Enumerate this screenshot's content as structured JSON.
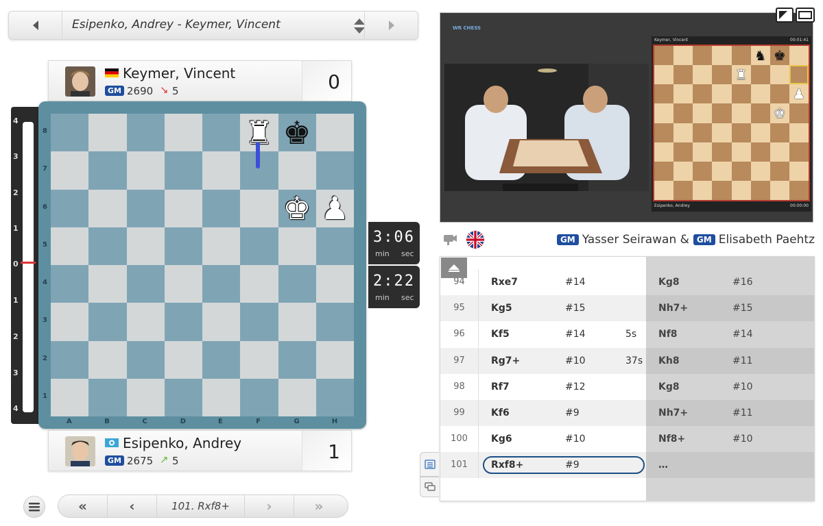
{
  "game_selector": {
    "title": "Esipenko, Andrey - Keymer, Vincent",
    "prev_icon": "chevron-left-icon",
    "next_icon": "chevron-right-icon"
  },
  "players": {
    "top": {
      "name": "Keymer, Vincent",
      "title": "GM",
      "rating": "2690",
      "trend": "↘",
      "rating_change": "5",
      "score": "0",
      "flag": "germany-flag"
    },
    "bottom": {
      "name": "Esipenko, Andrey",
      "title": "GM",
      "rating": "2675",
      "trend": "↗",
      "rating_change": "5",
      "score": "1",
      "flag": "fide-flag"
    }
  },
  "eval_bar": {
    "ticks_top": [
      "4",
      "3",
      "2",
      "1"
    ],
    "zero": "0",
    "ticks_bottom": [
      "1",
      "2",
      "3",
      "4"
    ]
  },
  "board": {
    "ranks": [
      "8",
      "7",
      "6",
      "5",
      "4",
      "3",
      "2",
      "1"
    ],
    "files": [
      "A",
      "B",
      "C",
      "D",
      "E",
      "F",
      "G",
      "H"
    ],
    "pieces": [
      {
        "square": "f8",
        "glyph": "♜",
        "color": "w"
      },
      {
        "square": "g8",
        "glyph": "♚",
        "color": "b"
      },
      {
        "square": "g6",
        "glyph": "♚",
        "color": "w"
      },
      {
        "square": "h6",
        "glyph": "♟",
        "color": "w"
      }
    ],
    "last_move": {
      "from": "f7",
      "to": "f8"
    },
    "light_color": "#d3d7d8",
    "dark_color": "#7fa5b5",
    "arrow_color": "#3b4ed8"
  },
  "clocks": {
    "top": {
      "time": "3:06",
      "min": "min",
      "sec": "sec"
    },
    "bottom": {
      "time": "2:22",
      "min": "min",
      "sec": "sec"
    }
  },
  "navigation": {
    "first": "«",
    "prev": "‹",
    "current": "101. Rxf8+",
    "next": "›",
    "last": "»"
  },
  "video": {
    "logo": "WR CHESS",
    "top_player": "Keymer, Vincent",
    "bottom_player": "Esipenko, Andrey",
    "top_time": "00:01:41",
    "bottom_time": "00:00:00",
    "pieces": [
      {
        "square": "f8",
        "glyph": "♞",
        "color": "b"
      },
      {
        "square": "g8",
        "glyph": "♚",
        "color": "b"
      },
      {
        "square": "e7",
        "glyph": "♜",
        "color": "w"
      },
      {
        "square": "h6",
        "glyph": "♟",
        "color": "w"
      },
      {
        "square": "g5",
        "glyph": "♚",
        "color": "w"
      }
    ]
  },
  "commentary": {
    "language": "English",
    "commentator_1": {
      "title": "GM",
      "name": "Yasser Seirawan &"
    },
    "commentator_2": {
      "title": "GM",
      "name": "Elisabeth Paehtz"
    }
  },
  "moves": [
    {
      "num": "94",
      "white": "Rxe7",
      "white_eval": "#14",
      "white_time": "",
      "black": "Kg8",
      "black_eval": "#16"
    },
    {
      "num": "95",
      "white": "Kg5",
      "white_eval": "#15",
      "white_time": "",
      "black": "Nh7+",
      "black_eval": "#15"
    },
    {
      "num": "96",
      "white": "Kf5",
      "white_eval": "#14",
      "white_time": "5s",
      "black": "Nf8",
      "black_eval": "#14"
    },
    {
      "num": "97",
      "white": "Rg7+",
      "white_eval": "#10",
      "white_time": "37s",
      "black": "Kh8",
      "black_eval": "#11"
    },
    {
      "num": "98",
      "white": "Rf7",
      "white_eval": "#12",
      "white_time": "",
      "black": "Kg8",
      "black_eval": "#10"
    },
    {
      "num": "99",
      "white": "Kf6",
      "white_eval": "#9",
      "white_time": "",
      "black": "Nh7+",
      "black_eval": "#11"
    },
    {
      "num": "100",
      "white": "Kg6",
      "white_eval": "#10",
      "white_time": "",
      "black": "Nf8+",
      "black_eval": "#10"
    },
    {
      "num": "101",
      "white": "Rxf8+",
      "white_eval": "#9",
      "white_time": "",
      "black": "…",
      "black_eval": ""
    }
  ]
}
